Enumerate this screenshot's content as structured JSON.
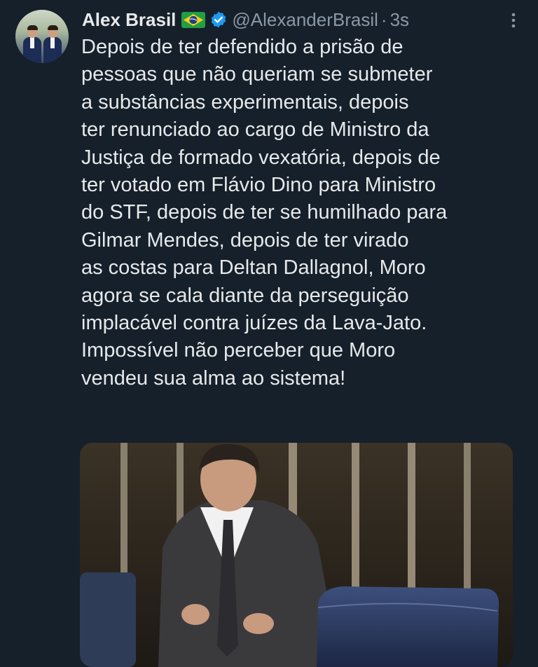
{
  "tweet": {
    "author_name": "Alex Brasil",
    "handle": "@AlexanderBrasil",
    "separator": "·",
    "time": "3s",
    "flag_icon": "brazil-flag-icon",
    "verified_icon": "verified-badge-icon",
    "more_icon": "more-options-icon",
    "text_lines": [
      "Depois de ter defendido a prisão de",
      "pessoas que não queriam se submeter",
      "a substâncias experimentais, depois",
      "ter renunciado ao cargo de Ministro da",
      "Justiça de formado vexatória, depois de",
      "ter votado em Flávio Dino para Ministro",
      "do STF, depois de ter se humilhado para",
      "Gilmar Mendes, depois de ter virado",
      "as costas para Deltan Dallagnol, Moro",
      "agora se cala diante da perseguição",
      "implacável contra juízes da Lava-Jato.",
      "Impossível não perceber que Moro",
      "vendeu sua alma ao sistema!"
    ]
  },
  "colors": {
    "background": "#15202b",
    "text": "#e7e9ea",
    "muted": "#8b98a5",
    "verified": "#1d9bf0"
  }
}
